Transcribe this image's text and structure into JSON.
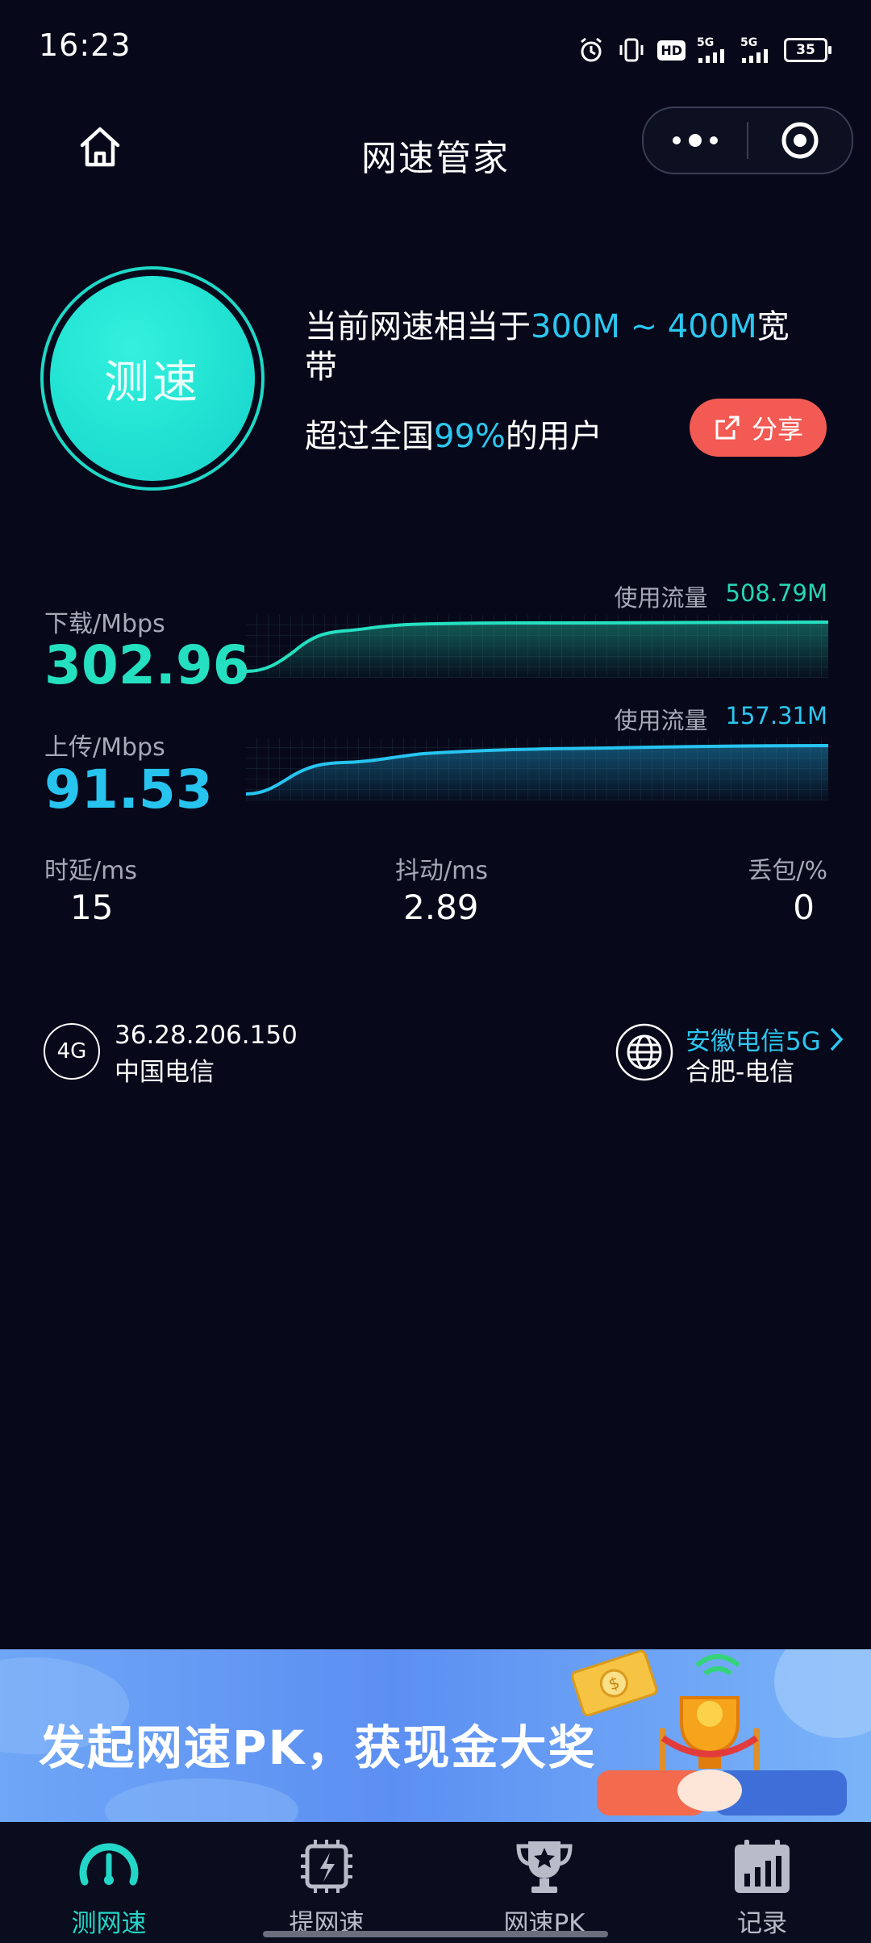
{
  "status_bar": {
    "time": "16:23",
    "network1": "5G",
    "network2": "5G",
    "hd_label": "HD",
    "battery": "35",
    "icons": [
      "alarm-icon",
      "vibrate-icon",
      "hd-icon",
      "signal-icon",
      "signal-icon",
      "battery-icon"
    ]
  },
  "header": {
    "title": "网速管家",
    "icons": [
      "home-icon",
      "more-dots-icon",
      "target-icon"
    ]
  },
  "speed_test": {
    "button_label": "测速",
    "summary_prefix": "当前网速相当于",
    "summary_highlight": "300M ~ 400M",
    "summary_suffix": "宽带",
    "rank_prefix": "超过全国",
    "rank_highlight": "99%",
    "rank_suffix": "的用户",
    "share_label": "分享"
  },
  "download": {
    "label": "下载/Mbps",
    "value": "302.96",
    "usage_label": "使用流量",
    "usage_value": "508.79M"
  },
  "upload": {
    "label": "上传/Mbps",
    "value": "91.53",
    "usage_label": "使用流量",
    "usage_value": "157.31M"
  },
  "metrics": [
    {
      "label": "时延/ms",
      "value": "15"
    },
    {
      "label": "抖动/ms",
      "value": "2.89"
    },
    {
      "label": "丢包/%",
      "value": "0"
    }
  ],
  "network": {
    "badge": "4G",
    "ip": "36.28.206.150",
    "isp": "中国电信",
    "server_name": "安徽电信5G",
    "server_location": "合肥-电信"
  },
  "banner": {
    "text": "发起网速PK，获现金大奖"
  },
  "tabs": [
    {
      "label": "测网速",
      "icon": "speedometer-icon",
      "active": true
    },
    {
      "label": "提网速",
      "icon": "chip-boost-icon",
      "active": false
    },
    {
      "label": "网速PK",
      "icon": "trophy-icon",
      "active": false
    },
    {
      "label": "记录",
      "icon": "calendar-chart-icon",
      "active": false
    }
  ],
  "colors": {
    "background": "#07091a",
    "download_accent": "#25e0c0",
    "upload_accent": "#27c4f0",
    "share_button": "#f25a53"
  }
}
